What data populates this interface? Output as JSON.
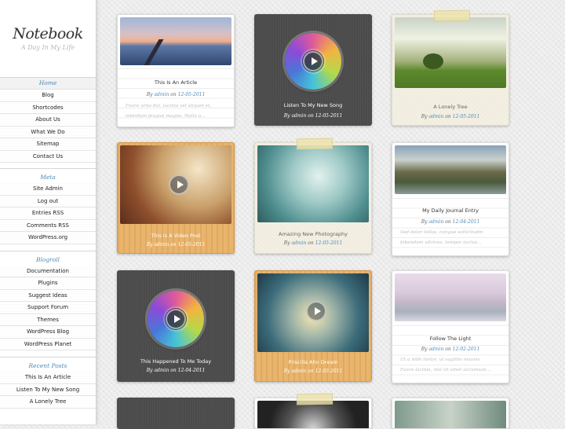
{
  "site": {
    "title": "Notebook",
    "tagline": "A Day In My Life"
  },
  "nav": {
    "current": "Home",
    "items": [
      "Blog",
      "Shortcodes",
      "About Us",
      "What We Do",
      "Sitemap",
      "Contact Us"
    ]
  },
  "meta": {
    "heading": "Meta",
    "items": [
      "Site Admin",
      "Log out",
      "Entries RSS",
      "Comments RSS",
      "WordPress.org"
    ]
  },
  "blogroll": {
    "heading": "Blogroll",
    "items": [
      "Documentation",
      "Plugins",
      "Suggest Ideas",
      "Support Forum",
      "Themes",
      "WordPress Blog",
      "WordPress Planet"
    ]
  },
  "recent": {
    "heading": "Recent Posts",
    "items": [
      "This Is An Article",
      "Listen To My New Song",
      "A Lonely Tree"
    ]
  },
  "posts": [
    {
      "title": "This Is An Article",
      "by": "By",
      "author": "admin",
      "on": "on",
      "date": "12-05-2011",
      "excerpt": [
        "Fusce urna dui, lacinia vel aliquet et,",
        "interdum feugiat magna. Nulla a..."
      ]
    },
    {
      "title": "Listen To My New Song",
      "by": "By",
      "author": "admin",
      "on": "on",
      "date": "12-05-2011"
    },
    {
      "title": "A Lonely Tree",
      "by": "By",
      "author": "admin",
      "on": "on",
      "date": "12-05-2011"
    },
    {
      "title": "This Is A Video Post",
      "by": "By",
      "author": "admin",
      "on": "on",
      "date": "12-05-2011"
    },
    {
      "title": "Amazing New Photography",
      "by": "By",
      "author": "admin",
      "on": "on",
      "date": "12-05-2011"
    },
    {
      "title": "My Daily Journal Entry",
      "by": "By",
      "author": "admin",
      "on": "on",
      "date": "12-04-2011",
      "excerpt": [
        "Sed dolor tellus, congue sollicitudin",
        "bibendum ultrices, tempor luctus..."
      ]
    },
    {
      "title": "This Happened To Me Today",
      "by": "By",
      "author": "admin",
      "on": "on",
      "date": "12-04-2011"
    },
    {
      "title": "Priscilla Ahn Dream",
      "by": "By",
      "author": "admin",
      "on": "on",
      "date": "12-03-2011"
    },
    {
      "title": "Follow The Light",
      "by": "By",
      "author": "admin",
      "on": "on",
      "date": "12-02-2011",
      "excerpt": [
        "Ut a nibh tortor, ut sagittis mauris.",
        "Fusce lacinia, nisl sit amet accumsan..."
      ]
    }
  ],
  "colors": {
    "accent": "#4d8ab8",
    "wood": "#e9b46c",
    "dark_card": "#4b4b4b"
  },
  "icons": {
    "play": "play-icon",
    "disc": "music-disc-icon"
  }
}
